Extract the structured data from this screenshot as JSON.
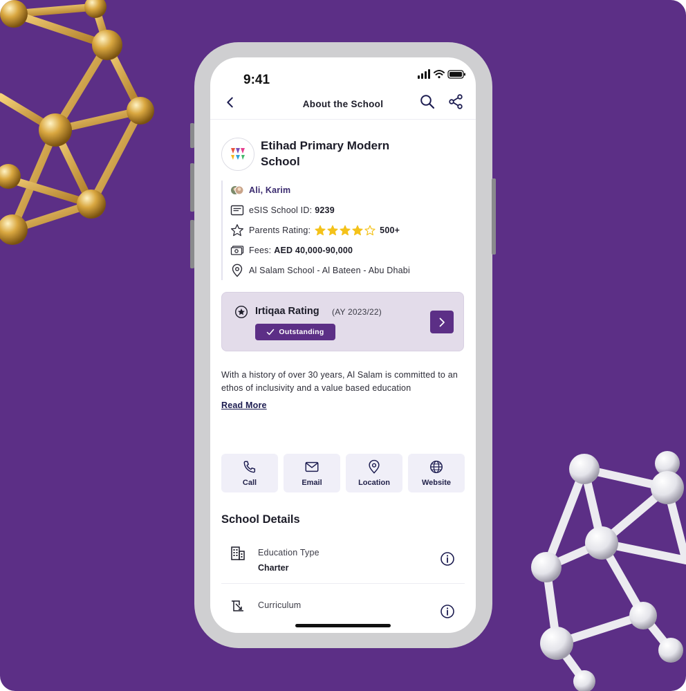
{
  "colors": {
    "background": "#5c2f86",
    "accent": "#5c2f86",
    "card": "#e3dcea",
    "star": "#f4c21a",
    "action_bg": "#f0eff8"
  },
  "status_bar": {
    "time": "9:41",
    "icons": [
      "signal-icon",
      "wifi-icon",
      "battery-icon"
    ]
  },
  "header": {
    "title": "About the School",
    "back_icon": "chevron-left-icon",
    "search_icon": "search-icon",
    "share_icon": "share-icon"
  },
  "school": {
    "name": "Etihad Primary Modern School",
    "contact_name": "Ali, Karim",
    "esis_label": "eSIS School ID:",
    "esis_id": "9239",
    "rating_label": "Parents Rating:",
    "rating_stars": 4,
    "rating_max": 5,
    "rating_count": "500+",
    "fees_label": "Fees:",
    "fees_value": "AED 40,000-90,000",
    "address": "Al Salam School - Al Bateen - Abu Dhabi"
  },
  "irtiqaa": {
    "title": "Irtiqaa Rating",
    "year": "(AY 2023/22)",
    "badge": "Outstanding"
  },
  "about": {
    "text": "With a history of over 30 years, Al Salam is committed to an ethos of inclusivity and a value based education",
    "read_more": "Read More"
  },
  "actions": [
    {
      "label": "Call",
      "icon": "phone-icon"
    },
    {
      "label": "Email",
      "icon": "mail-icon"
    },
    {
      "label": "Location",
      "icon": "location-pin-icon"
    },
    {
      "label": "Website",
      "icon": "globe-icon"
    }
  ],
  "details": {
    "title": "School Details",
    "items": [
      {
        "label": "Education Type",
        "value": "Charter",
        "icon": "building-icon"
      },
      {
        "label": "Curriculum",
        "value": "",
        "icon": "curriculum-icon"
      }
    ]
  }
}
